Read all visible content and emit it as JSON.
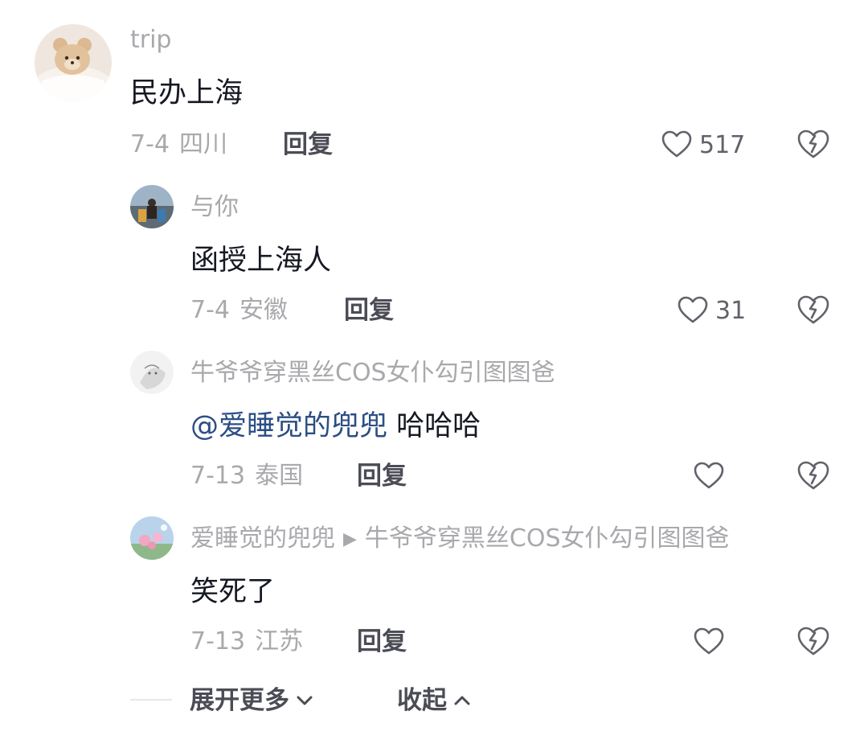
{
  "comments": [
    {
      "username": "trip",
      "content": "民办上海",
      "date": "7-4",
      "location": "四川",
      "reply_label": "回复",
      "likes": "517"
    }
  ],
  "replies": [
    {
      "username": "与你",
      "content": "函授上海人",
      "date": "7-4",
      "location": "安徽",
      "reply_label": "回复",
      "likes": "31"
    },
    {
      "username": "牛爷爷穿黑丝COS女仆勾引图图爸",
      "mention": "@爱睡觉的兜兜",
      "content": "哈哈哈",
      "date": "7-13",
      "location": "泰国",
      "reply_label": "回复",
      "likes": ""
    },
    {
      "username": "爱睡觉的兜兜",
      "reply_to": "牛爷爷穿黑丝COS女仆勾引图图爸",
      "content": "笑死了",
      "date": "7-13",
      "location": "江苏",
      "reply_label": "回复",
      "likes": ""
    }
  ],
  "footer": {
    "expand_label": "展开更多",
    "collapse_label": "收起"
  },
  "icons": {
    "like": "heart-outline-icon",
    "dislike": "broken-heart-icon",
    "expand": "chevron-down-icon",
    "collapse": "chevron-up-icon",
    "reply_arrow": "play-triangle-icon"
  },
  "colors": {
    "mention": "#2c4e85",
    "username": "#a9a9ad",
    "text": "#161823"
  }
}
